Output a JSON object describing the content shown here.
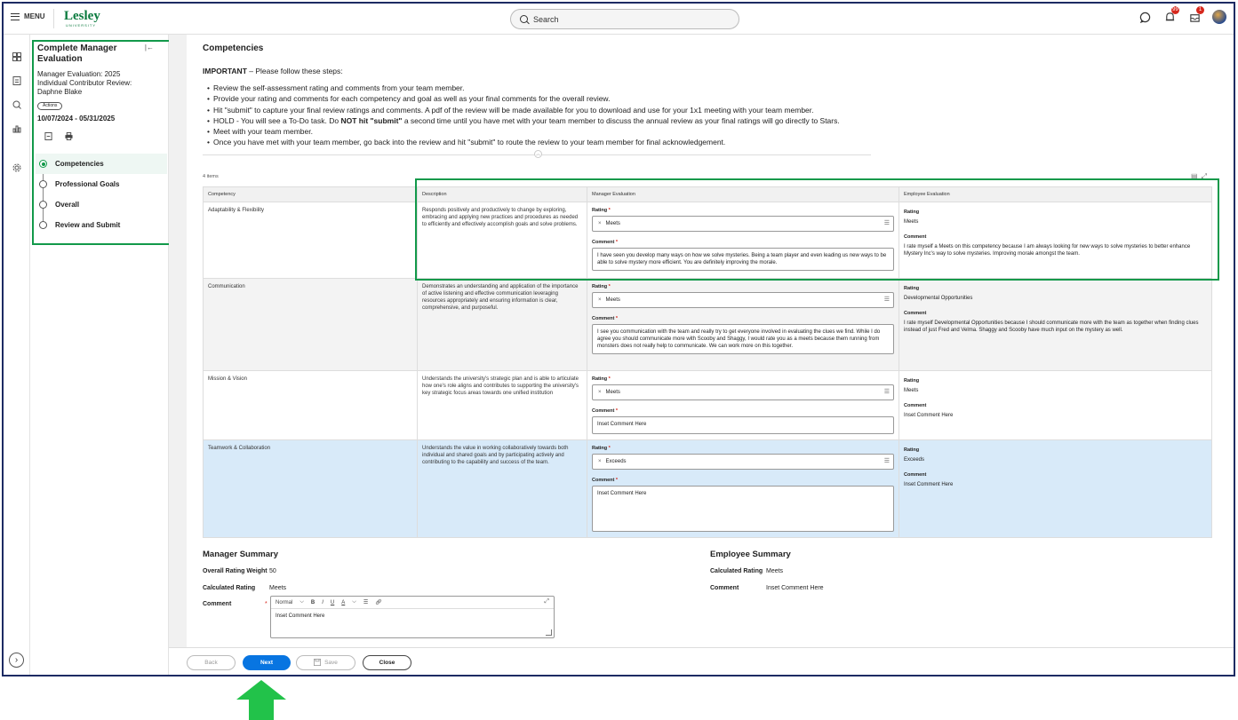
{
  "topbar": {
    "menu_label": "MENU",
    "logo": "Lesley",
    "logo_sub": "UNIVERSITY",
    "search_placeholder": "Search",
    "notifications_count": "99",
    "inbox_count": "1"
  },
  "task": {
    "title": "Complete Manager Evaluation",
    "subtitle_line1": "Manager Evaluation: 2025",
    "subtitle_line2": "Individual Contributor Review:",
    "subtitle_line3": "Daphne Blake",
    "actions_label": "Actions",
    "dates": "10/07/2024 - 05/31/2025",
    "steps": [
      {
        "label": "Competencies"
      },
      {
        "label": "Professional Goals"
      },
      {
        "label": "Overall"
      },
      {
        "label": "Review and Submit"
      }
    ]
  },
  "main": {
    "section_title": "Competencies",
    "important_label": "IMPORTANT",
    "important_text": " – Please follow these steps:",
    "bullets": [
      "Review the self-assessment rating and comments from your team member.",
      "Provide your rating and comments for each competency and goal as well as your final comments for the overall review.",
      "Hit \"submit\" to capture your final review ratings and comments. A pdf of the review will be made available for you to download and use for your 1x1 meeting with your team member.",
      "HOLD - You will see a To-Do task. Do NOT hit \"submit\" a second time until you have met with your team member to discuss the annual review as your final ratings will go directly to Stars.",
      "Meet with your team member.",
      "Once you have met with your team member, go back into the review and hit \"submit\" to route the review to your team member for final acknowledgement."
    ],
    "items_count": "4 items",
    "columns": {
      "competency": "Competency",
      "description": "Description",
      "manager": "Manager Evaluation",
      "employee": "Employee Evaluation"
    },
    "labels": {
      "rating": "Rating",
      "comment": "Comment",
      "required": "*"
    },
    "rows": [
      {
        "competency": "Adaptability & Flexibility",
        "description": "Responds positively and productively to change by exploring, embracing and applying new practices and procedures as needed to efficiently and effectively accomplish goals and solve problems.",
        "mgr_rating": "Meets",
        "mgr_comment": "I have seen you develop many ways on how we solve mysteries. Being a team player and even leading us new ways to be able to solve mystery more efficient. You are definitely improving the morale.",
        "emp_rating": "Meets",
        "emp_comment": "I rate myself a Meets on this competency because I am always looking for new ways to solve mysteries to better enhance Mystery Inc's way to solve mysteries. Improving morale amongst the team."
      },
      {
        "competency": "Communication",
        "description": "Demonstrates an understanding and application of the importance of active listening and effective communication leveraging resources appropriately and ensuring information is clear, comprehensive, and purposeful.",
        "mgr_rating": "Meets",
        "mgr_comment": "I see you communication with the team and really try to get everyone involved in evaluating the clues we find. While I do agree you should communicate more with Scooby and Shaggy, I would rate you as a meets because them running from monsters does not really help to communicate. We can work more on this together.",
        "emp_rating": "Developmental Opportunities",
        "emp_comment": "I rate myself Developmental Opportunities because I should communicate more with the team as together when finding clues instead of just Fred and Velma. Shaggy and Scooby have much input on the mystery as well."
      },
      {
        "competency": "Mission & Vision",
        "description": "Understands the university's strategic plan and is able to articulate how one's role aligns and contributes to supporting the university's key strategic focus areas towards one unified institution",
        "mgr_rating": "Meets",
        "mgr_comment": "Inset Comment Here",
        "emp_rating": "Meets",
        "emp_comment": "Inset Comment Here"
      },
      {
        "competency": "Teamwork & Collaboration",
        "description": "Understands the value in working collaboratively towards both individual and shared goals and by participating actively and contributing to the capability and success of the team.",
        "mgr_rating": "Exceeds",
        "mgr_comment": "Inset Comment Here",
        "emp_rating": "Exceeds",
        "emp_comment": "Inset Comment Here"
      }
    ]
  },
  "manager_summary": {
    "title": "Manager Summary",
    "weight_label": "Overall Rating Weight",
    "weight_value": "50",
    "calc_label": "Calculated Rating",
    "calc_value": "Meets",
    "comment_label": "Comment",
    "comment_value": "Inset Comment Here",
    "editor_style": "Normal"
  },
  "employee_summary": {
    "title": "Employee Summary",
    "calc_label": "Calculated Rating",
    "calc_value": "Meets",
    "comment_label": "Comment",
    "comment_value": "Inset Comment Here"
  },
  "footer": {
    "back": "Back",
    "next": "Next",
    "save": "Save",
    "close": "Close"
  },
  "colors": {
    "highlight_green": "#12994a",
    "primary_blue": "#0875e1",
    "frame_navy": "#1d2b63"
  }
}
